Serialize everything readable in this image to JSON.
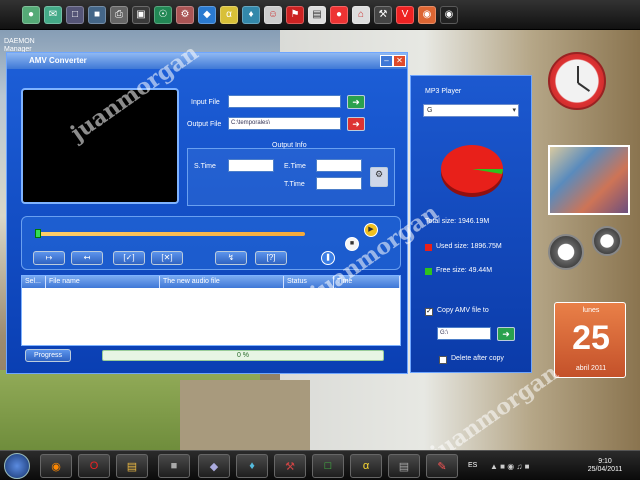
{
  "desktop": {
    "label": "DAEMON Manager",
    "watermark": "juanmorgan"
  },
  "topbar": {
    "icons": [
      "pin",
      "mail",
      "monitor",
      "photo",
      "print",
      "film",
      "globe",
      "gear",
      "chat",
      "star",
      "net",
      "person",
      "flag",
      "disk",
      "paint",
      "home",
      "tool",
      "v-icon",
      "browser",
      "eye"
    ]
  },
  "amv": {
    "title": "AMV Converter",
    "input_label": "Input File",
    "input_value": "",
    "output_label": "Output File",
    "output_value": "C:\\temporales\\",
    "output_info_label": "Output Info",
    "s_time_label": "S.Time",
    "e_time_label": "E.Time",
    "t_time_label": "T.Time",
    "s_time_value": "",
    "e_time_value": "",
    "t_time_value": "",
    "table_headers": [
      "Sel...",
      "File name",
      "The new audio file",
      "Status",
      "Time"
    ],
    "progress_label": "Progress",
    "progress_text": "0 %",
    "progress_value": 0
  },
  "mp3": {
    "title": "MP3 Player",
    "drive": "G",
    "total_size": "Total size: 1946.19M",
    "used_size": "Used size: 1896.75M",
    "free_size": "Free size: 49.44M",
    "used_color": "#e8201a",
    "free_color": "#2ec21c",
    "copy_label": "Copy AMV file to",
    "copy_checked": true,
    "copy_path": "G:\\",
    "delete_label": "Delete after copy",
    "delete_checked": false
  },
  "gadgets": {
    "calendar_day": "lunes",
    "calendar_date": "25",
    "calendar_month": "abril 2011"
  },
  "taskbar": {
    "items": [
      "firefox",
      "opera",
      "explorer",
      "app",
      "network",
      "game",
      "monitor",
      "winamp",
      "tool",
      "paint"
    ],
    "lang": "ES",
    "time": "9:10",
    "date": "25/04/2011"
  }
}
